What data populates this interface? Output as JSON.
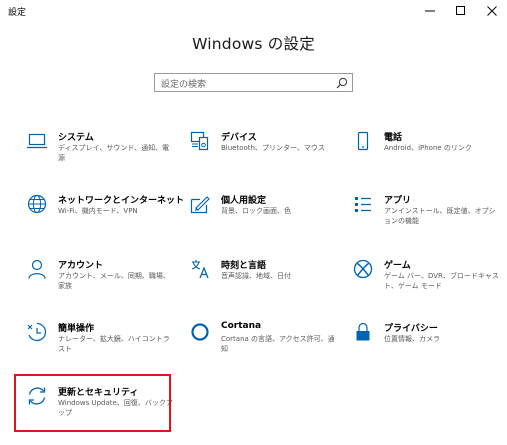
{
  "window": {
    "title": "設定"
  },
  "heading": "Windows の設定",
  "search": {
    "placeholder": "設定の検索"
  },
  "tiles": [
    {
      "icon": "laptop-icon",
      "title": "システム",
      "desc": "ディスプレイ、サウンド、通知、電源"
    },
    {
      "icon": "devices-icon",
      "title": "デバイス",
      "desc": "Bluetooth、プリンター、マウス"
    },
    {
      "icon": "phone-icon",
      "title": "電話",
      "desc": "Android、iPhone のリンク"
    },
    {
      "icon": "globe-icon",
      "title": "ネットワークとインターネット",
      "desc": "Wi-Fi、機内モード、VPN"
    },
    {
      "icon": "personalization-icon",
      "title": "個人用設定",
      "desc": "背景、ロック画面、色"
    },
    {
      "icon": "apps-icon",
      "title": "アプリ",
      "desc": "アンインストール、既定値、オプションの機能"
    },
    {
      "icon": "person-icon",
      "title": "アカウント",
      "desc": "アカウント、メール、同期、職場、家族"
    },
    {
      "icon": "language-icon",
      "title": "時刻と言語",
      "desc": "音声認識、地域、日付"
    },
    {
      "icon": "xbox-icon",
      "title": "ゲーム",
      "desc": "ゲーム バー、DVR、ブロードキャスト、ゲーム モード"
    },
    {
      "icon": "ease-of-access-icon",
      "title": "簡単操作",
      "desc": "ナレーター、拡大鏡、ハイコントラスト"
    },
    {
      "icon": "cortana-icon",
      "title": "Cortana",
      "desc": "Cortana の言語、アクセス許可、通知"
    },
    {
      "icon": "lock-icon",
      "title": "プライバシー",
      "desc": "位置情報、カメラ"
    },
    {
      "icon": "sync-icon",
      "title": "更新とセキュリティ",
      "desc": "Windows Update、回復、バックアップ"
    }
  ]
}
